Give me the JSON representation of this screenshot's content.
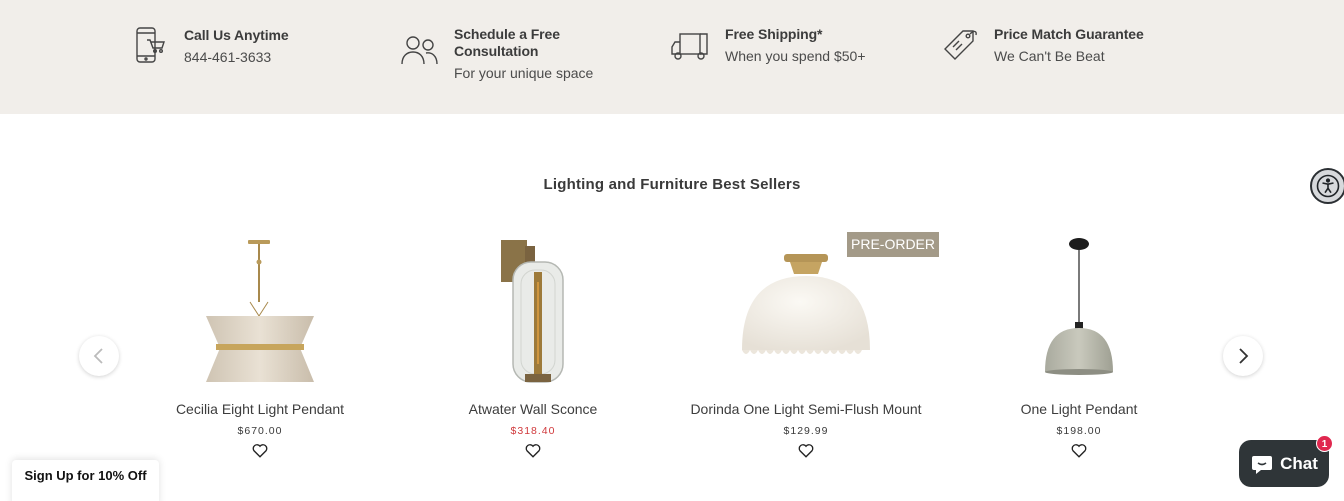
{
  "benefits": [
    {
      "icon": "phone-cart-icon",
      "title": "Call Us Anytime",
      "subtitle": "844-461-3633"
    },
    {
      "icon": "people-icon",
      "title": "Schedule a Free Consultation",
      "subtitle": "For your unique space"
    },
    {
      "icon": "truck-icon",
      "title": "Free Shipping*",
      "subtitle": "When you spend $50+"
    },
    {
      "icon": "price-tag-icon",
      "title": "Price Match Guarantee",
      "subtitle": "We Can't Be Beat"
    }
  ],
  "section": {
    "title": "Lighting and Furniture Best Sellers"
  },
  "products": [
    {
      "name": "Cecilia Eight Light Pendant",
      "price": "$670.00",
      "sale": false
    },
    {
      "name": "Atwater Wall Sconce",
      "price": "$318.40",
      "sale": true
    },
    {
      "name": "Dorinda One Light Semi-Flush Mount",
      "price": "$129.99",
      "sale": false,
      "badge": "PRE-ORDER"
    },
    {
      "name": "One Light Pendant",
      "price": "$198.00",
      "sale": false
    }
  ],
  "signup": {
    "label": "Sign Up for 10% Off"
  },
  "chat": {
    "label": "Chat",
    "unread_count": "1"
  },
  "colors": {
    "topbar_bg": "#f1eeea",
    "sale_price": "#d0393c",
    "badge_bg": "#a39a88",
    "chat_bg": "#2f3538",
    "chat_badge": "#e0284f"
  }
}
